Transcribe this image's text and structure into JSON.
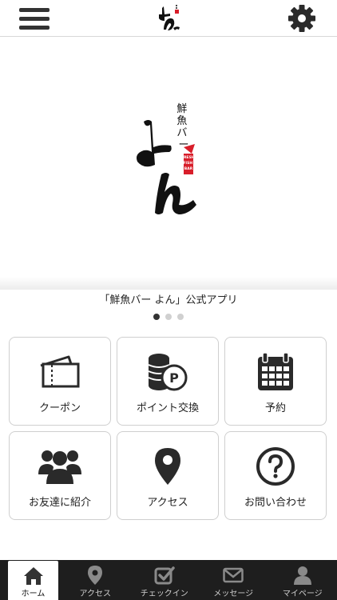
{
  "header": {
    "menu_icon": "hamburger-menu-icon",
    "logo_icon": "yon-brand-logo",
    "settings_icon": "gear-icon"
  },
  "hero": {
    "logo_vertical_text": "鮮魚バー",
    "logo_main_text": "よん",
    "logo_badge_text": "FRESH FISH BAR",
    "brand_red": "#d81e2a",
    "caption": "「鮮魚バー よん」公式アプリ",
    "slide_count": 3,
    "active_slide": 1
  },
  "menu_tiles": [
    {
      "label": "クーポン",
      "icon": "ticket-icon"
    },
    {
      "label": "ポイント交換",
      "icon": "coins-point-icon"
    },
    {
      "label": "予約",
      "icon": "calendar-icon"
    },
    {
      "label": "お友達に紹介",
      "icon": "users-group-icon"
    },
    {
      "label": "アクセス",
      "icon": "map-pin-icon"
    },
    {
      "label": "お問い合わせ",
      "icon": "question-circle-icon"
    }
  ],
  "tabbar": {
    "background": "#1e1e1e",
    "tabs": [
      {
        "label": "ホーム",
        "icon": "home-icon",
        "active": true
      },
      {
        "label": "アクセス",
        "icon": "map-pin-icon",
        "active": false
      },
      {
        "label": "チェックイン",
        "icon": "checkin-icon",
        "active": false
      },
      {
        "label": "メッセージ",
        "icon": "envelope-icon",
        "active": false
      },
      {
        "label": "マイページ",
        "icon": "user-icon",
        "active": false
      }
    ]
  }
}
